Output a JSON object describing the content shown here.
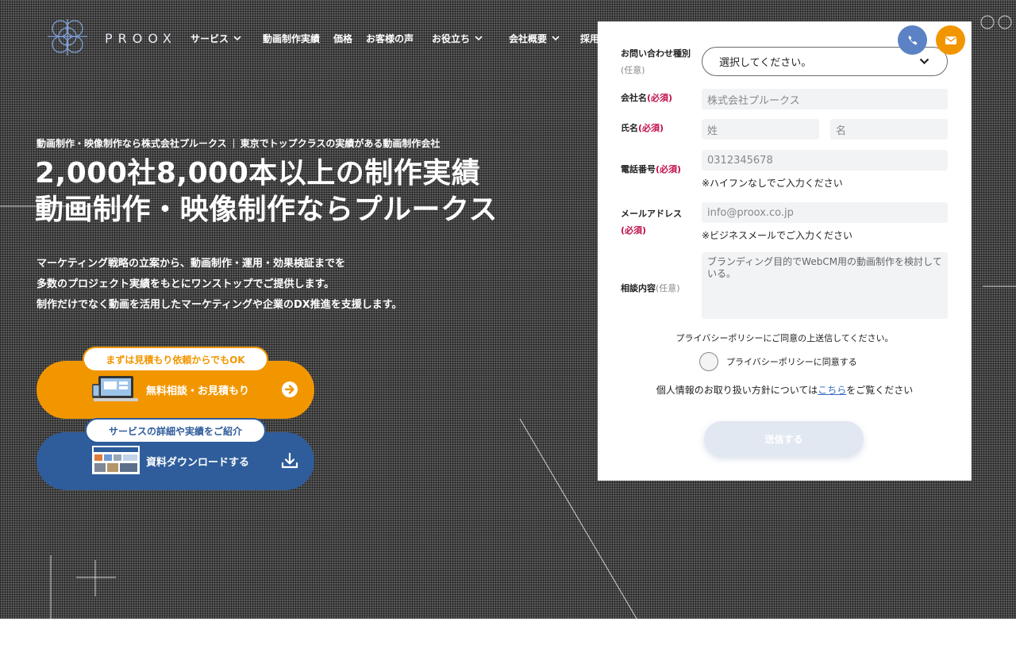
{
  "header": {
    "logo_text": "PROOX",
    "nav": [
      {
        "label": "サービス",
        "dropdown": true
      },
      {
        "label": "動画制作実績",
        "dropdown": false
      },
      {
        "label": "価格",
        "dropdown": false
      },
      {
        "label": "お客様の声",
        "dropdown": false
      },
      {
        "label": "お役立ち",
        "dropdown": true
      },
      {
        "label": "会社概要",
        "dropdown": true
      },
      {
        "label": "採用",
        "dropdown": false
      }
    ],
    "phone_icon": "phone-icon",
    "mail_icon": "envelope-icon"
  },
  "hero": {
    "kicker_left": "動画制作・映像制作なら株式会社プルークス",
    "kicker_right": "東京でトップクラスの実績がある動画制作会社",
    "headline_line1": "2,000社8,000本以上の制作実績",
    "headline_line2": "動画制作・映像制作ならプルークス",
    "lead_line1": "マーケティング戦略の立案から、動画制作・運用・効果検証までを",
    "lead_line2": "多数のプロジェクト実績をもとにワンストップでご提供します。",
    "lead_line3": "制作だけでなく動画を活用したマーケティングや企業のDX推進を支援します。"
  },
  "cta": {
    "estimate": {
      "tag": "まずは見積もり依頼からでもOK",
      "label": "無料相談・お見積もり",
      "icon": "arrow-right-circle-icon"
    },
    "download": {
      "tag": "サービスの詳細や実績をご紹介",
      "label": "資料ダウンロードする",
      "icon": "download-icon"
    }
  },
  "form": {
    "inquiry_type": {
      "label": "お問い合わせ種別",
      "tag": "(任意)",
      "value": "選択してください。"
    },
    "company": {
      "label": "会社名",
      "tag": "(必須)",
      "placeholder": "株式会社プルークス"
    },
    "name": {
      "label": "氏名",
      "tag": "(必須)",
      "last_placeholder": "姓",
      "first_placeholder": "名"
    },
    "phone": {
      "label": "電話番号",
      "tag": "(必須)",
      "placeholder": "0312345678",
      "note": "※ハイフンなしでご入力ください"
    },
    "email": {
      "label": "メールアドレス",
      "tag": "(必須)",
      "placeholder": "info@proox.co.jp",
      "note": "※ビジネスメールでご入力ください"
    },
    "message": {
      "label": "相談内容",
      "tag": "(任意)",
      "placeholder": "ブランディング目的でWebCM用の動画制作を検討している。"
    },
    "privacy_note": "プライバシーポリシーにご同意の上送信してください。",
    "privacy_check": "プライバシーポリシーに同意する",
    "policy_before": "個人情報のお取り扱い方針については",
    "policy_link": "こちら",
    "policy_after": "をご覧ください",
    "submit": "送信する"
  },
  "colors": {
    "orange": "#f29600",
    "blue": "#2f5d9b",
    "required": "#c0104a"
  }
}
